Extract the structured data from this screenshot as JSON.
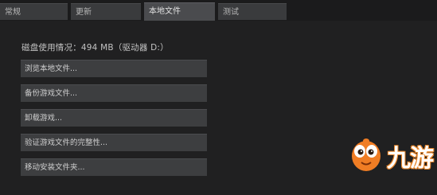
{
  "tabs": [
    {
      "label": "常规",
      "active": false
    },
    {
      "label": "更新",
      "active": false
    },
    {
      "label": "本地文件",
      "active": true
    },
    {
      "label": "测试",
      "active": false
    }
  ],
  "local_files": {
    "disk_usage": "磁盘使用情况：494 MB（驱动器 D:）",
    "buttons": [
      {
        "label": "浏览本地文件..."
      },
      {
        "label": "备份游戏文件..."
      },
      {
        "label": "卸载游戏..."
      },
      {
        "label": "验证游戏文件的完整性..."
      },
      {
        "label": "移动安装文件夹..."
      }
    ]
  },
  "watermark": {
    "text": "九游",
    "icon": "jiuyou-mascot-icon",
    "accent_color": "#f07d24"
  }
}
